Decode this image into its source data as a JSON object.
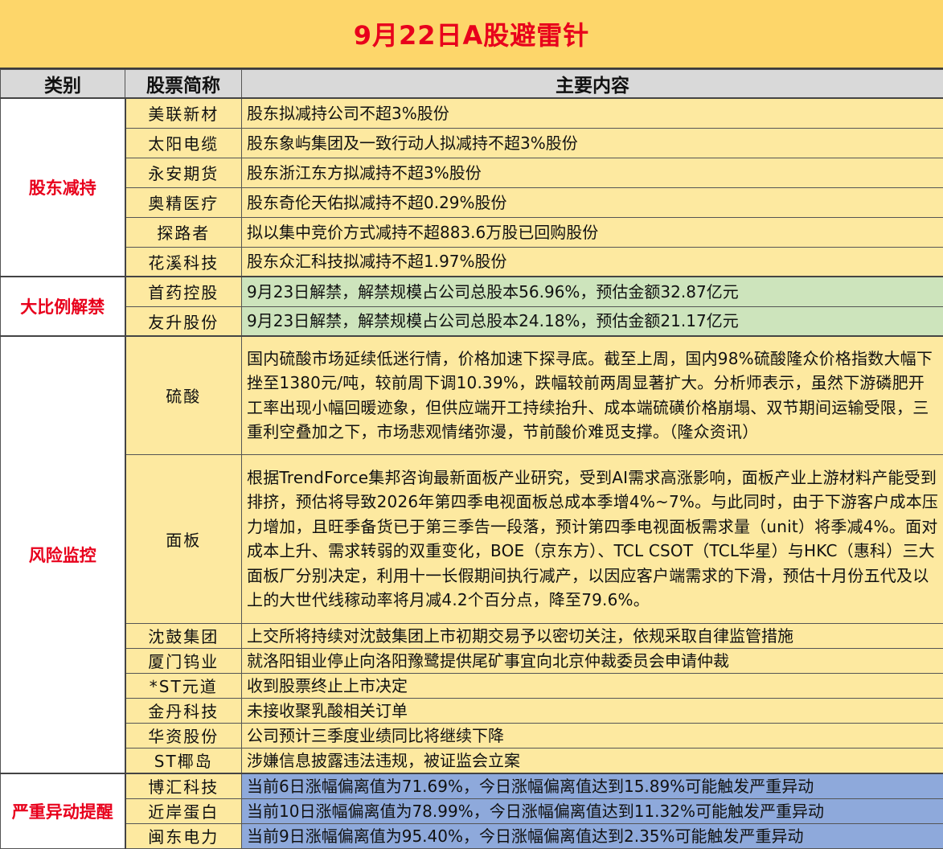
{
  "title": "9月22日A股避雷针",
  "header": {
    "category": "类别",
    "stock": "股票简称",
    "content": "主要内容"
  },
  "sections": {
    "reduce": {
      "category": "股东减持",
      "rows": [
        {
          "name": "美联新材",
          "content": "股东拟减持公司不超3%股份"
        },
        {
          "name": "太阳电缆",
          "content": "股东象屿集团及一致行动人拟减持不超3%股份"
        },
        {
          "name": "永安期货",
          "content": "股东浙江东方拟减持不超3%股份"
        },
        {
          "name": "奥精医疗",
          "content": "股东奇伦天佑拟减持不超0.29%股份"
        },
        {
          "name": "探路者",
          "content": "拟以集中竞价方式减持不超883.6万股已回购股份"
        },
        {
          "name": "花溪科技",
          "content": "股东众汇科技拟减持不超1.97%股份"
        }
      ]
    },
    "unlock": {
      "category": "大比例解禁",
      "rows": [
        {
          "name": "首药控股",
          "content": "9月23日解禁，解禁规模占公司总股本56.96%，预估金额32.87亿元"
        },
        {
          "name": "友升股份",
          "content": "9月23日解禁，解禁规模占公司总股本24.18%，预估金额21.17亿元"
        }
      ]
    },
    "risk": {
      "category": "风险监控",
      "rows": [
        {
          "name": "硫酸",
          "content": "国内硫酸市场延续低迷行情，价格加速下探寻底。截至上周，国内98%硫酸隆众价格指数大幅下挫至1380元/吨，较前周下调10.39%，跌幅较前两周显著扩大。分析师表示，虽然下游磷肥开工率出现小幅回暖迹象，但供应端开工持续抬升、成本端硫磺价格崩塌、双节期间运输受限，三重利空叠加之下，市场悲观情绪弥漫，节前酸价难觅支撑。（隆众资讯）"
        },
        {
          "name": "面板",
          "content": "根据TrendForce集邦咨询最新面板产业研究，受到AI需求高涨影响，面板产业上游材料产能受到排挤，预估将导致2026年第四季电视面板总成本季增4%~7%。与此同时，由于下游客户成本压力增加，且旺季备货已于第三季告一段落，预计第四季电视面板需求量（unit）将季减4%。面对成本上升、需求转弱的双重变化，BOE（京东方）、TCL CSOT（TCL华星）与HKC（惠科）三大面板厂分别决定，利用十一长假期间执行减产，以因应客户端需求的下滑，预估十月份五代及以上的大世代线稼动率将月减4.2个百分点，降至79.6%。"
        },
        {
          "name": "沈鼓集团",
          "content": "上交所将持续对沈鼓集团上市初期交易予以密切关注，依规采取自律监管措施"
        },
        {
          "name": "厦门钨业",
          "content": "就洛阳钼业停止向洛阳豫鹭提供尾矿事宜向北京仲裁委员会申请仲裁"
        },
        {
          "name": "*ST元道",
          "content": "收到股票终止上市决定"
        },
        {
          "name": "金丹科技",
          "content": "未接收聚乳酸相关订单"
        },
        {
          "name": "华资股份",
          "content": "公司预计三季度业绩同比将继续下降"
        },
        {
          "name": "ST椰岛",
          "content": "涉嫌信息披露违法违规，被证监会立案"
        }
      ]
    },
    "abnormal": {
      "category": "严重异动提醒",
      "rows": [
        {
          "name": "博汇科技",
          "content": "当前6日涨幅偏离值为71.69%，今日涨幅偏离值达到15.89%可能触发严重异动"
        },
        {
          "name": "近岸蛋白",
          "content": "当前10日涨幅偏离值为78.99%，今日涨幅偏离值达到11.32%可能触发严重异动"
        },
        {
          "name": "闽东电力",
          "content": "当前9日涨幅偏离值为95.40%，今日涨幅偏离值达到2.35%可能触发严重异动"
        }
      ]
    }
  },
  "colors": {
    "title_bg": "#fdd66a",
    "title_text": "#e8001c",
    "category_text": "#e8001c",
    "content_yellow": "#fde9a0",
    "content_green": "#cde4bc",
    "content_blue": "#8ea9db"
  }
}
